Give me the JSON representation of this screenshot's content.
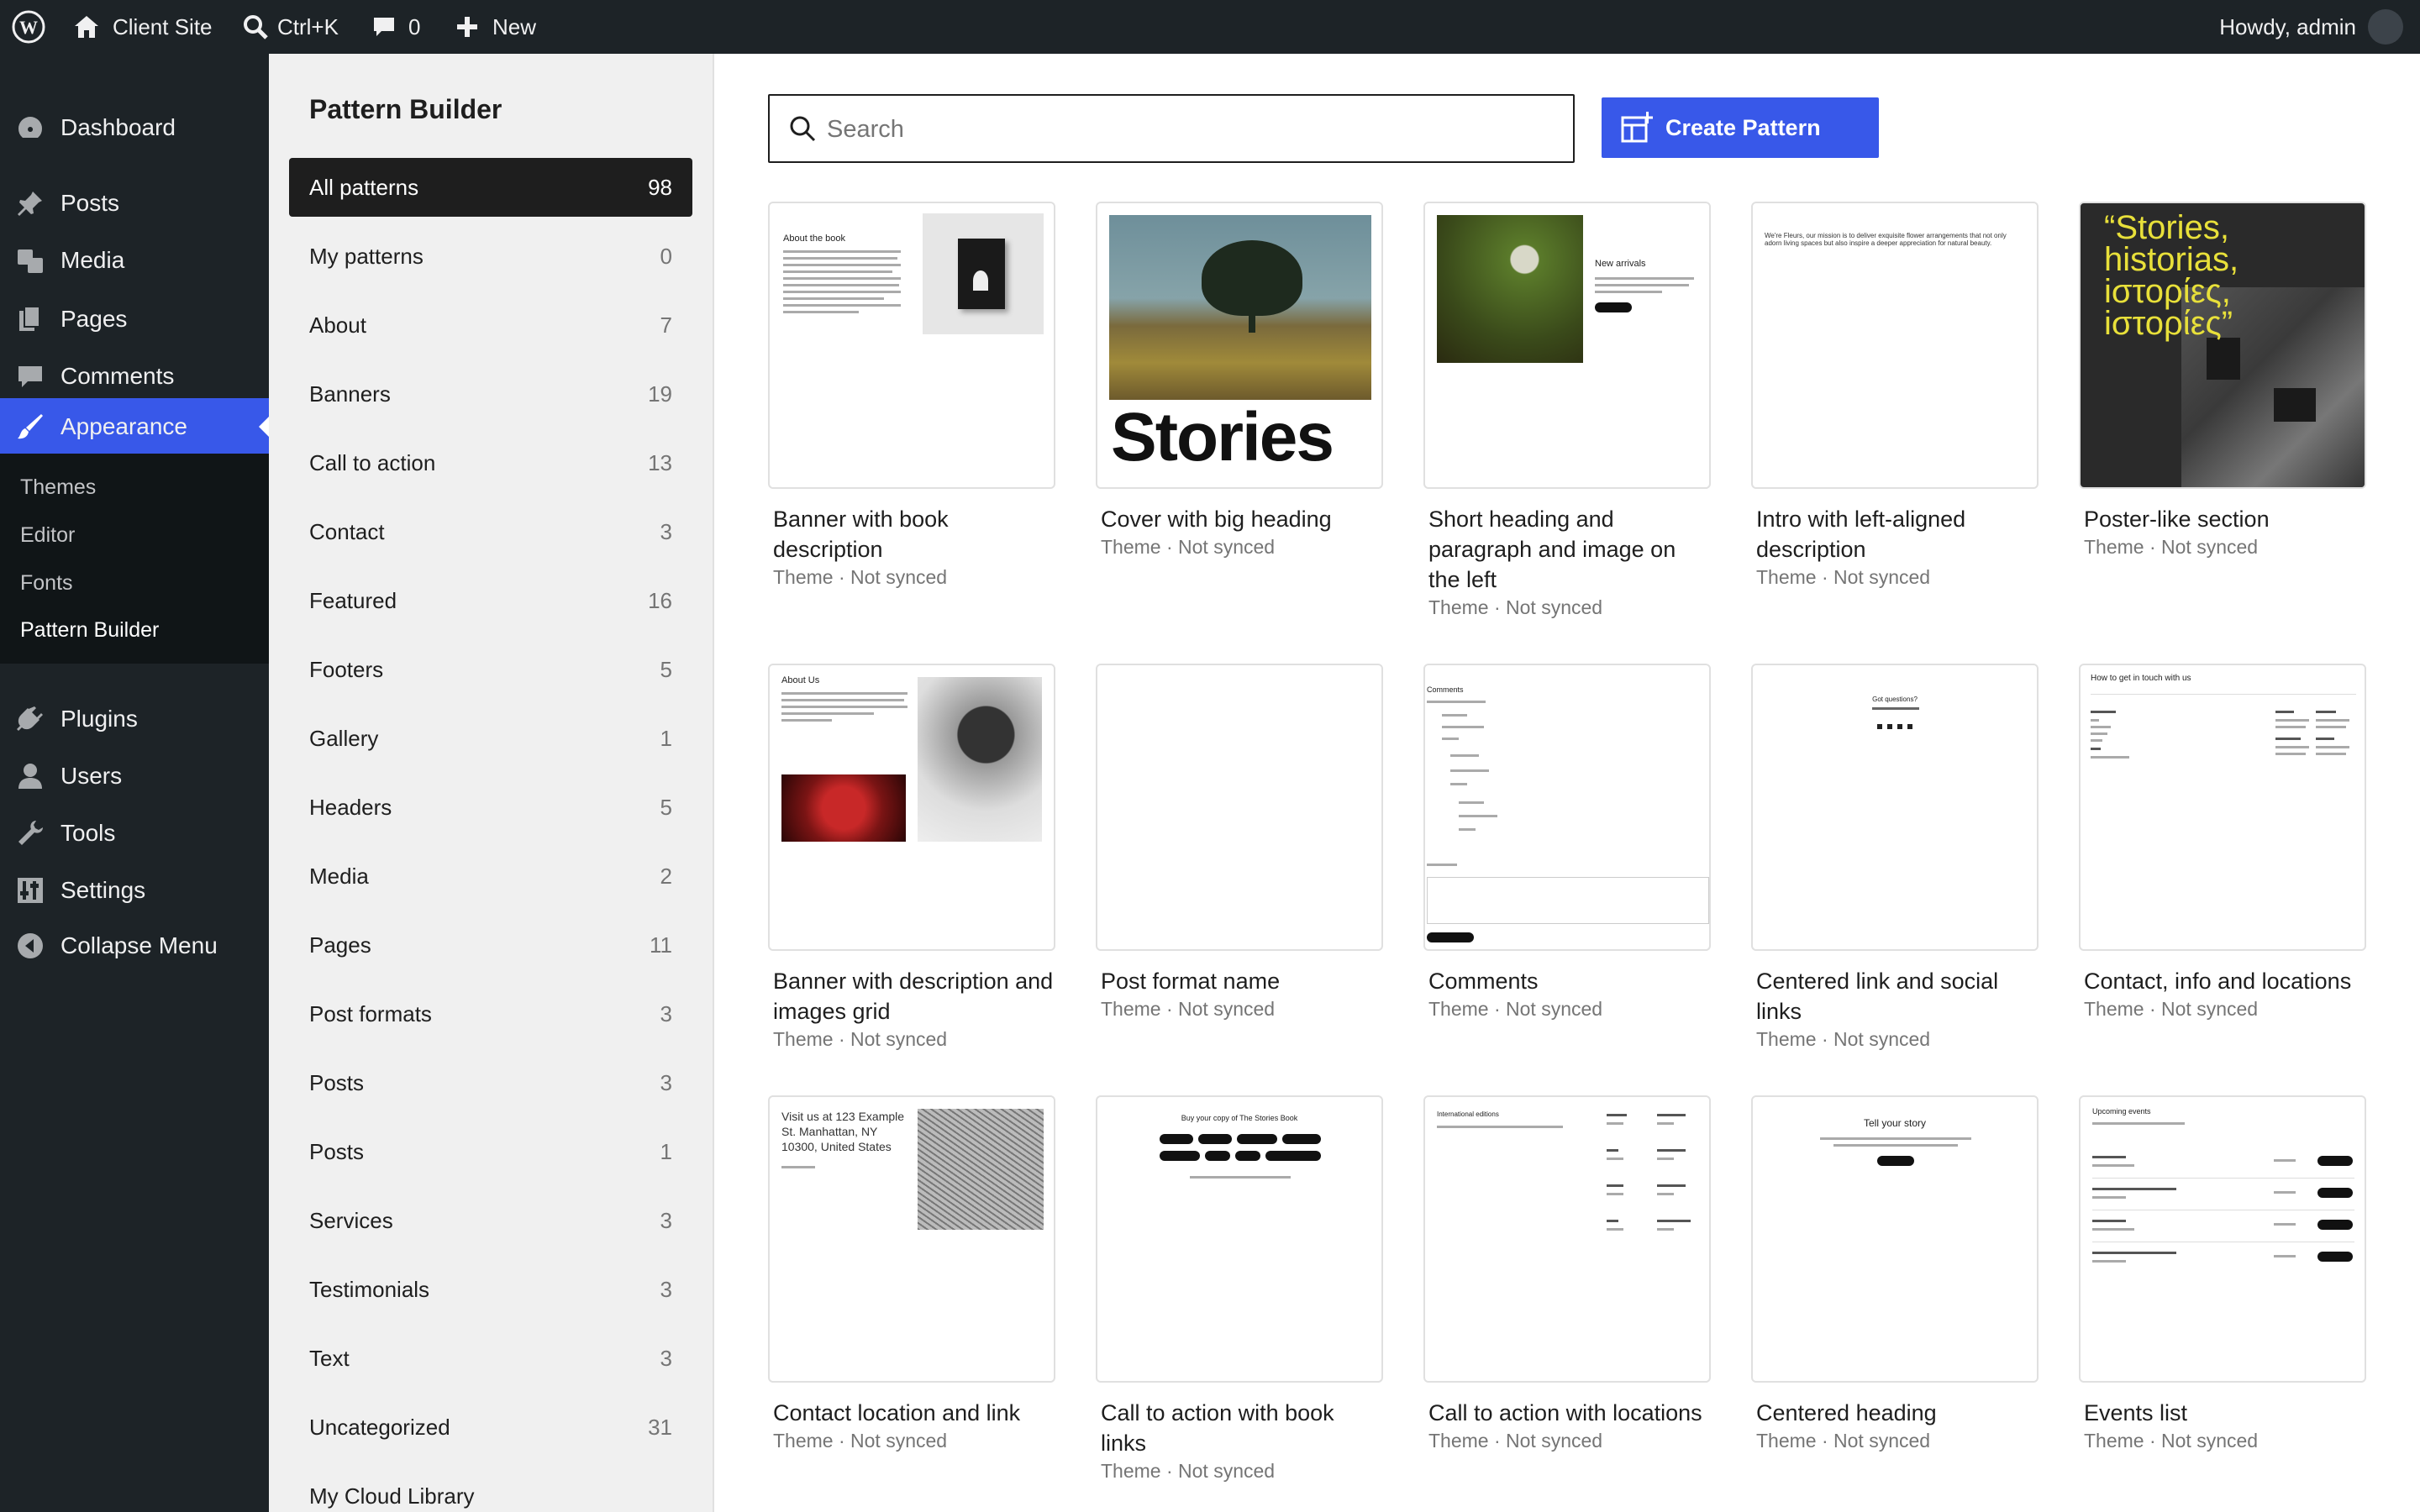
{
  "adminbar": {
    "site_name": "Client Site",
    "search_shortcut": "Ctrl+K",
    "comments_count": "0",
    "new_label": "New",
    "greeting": "Howdy, admin"
  },
  "admin_menu": {
    "items": [
      {
        "label": "Dashboard",
        "icon": "dashboard-icon"
      },
      {
        "label": "Posts",
        "icon": "pin-icon"
      },
      {
        "label": "Media",
        "icon": "media-icon"
      },
      {
        "label": "Pages",
        "icon": "pages-icon"
      },
      {
        "label": "Comments",
        "icon": "comment-icon"
      },
      {
        "label": "Appearance",
        "icon": "brush-icon"
      },
      {
        "label": "Plugins",
        "icon": "plug-icon"
      },
      {
        "label": "Users",
        "icon": "user-icon"
      },
      {
        "label": "Tools",
        "icon": "wrench-icon"
      },
      {
        "label": "Settings",
        "icon": "sliders-icon"
      },
      {
        "label": "Collapse Menu",
        "icon": "collapse-icon"
      }
    ],
    "submenu": [
      "Themes",
      "Editor",
      "Fonts",
      "Pattern Builder"
    ]
  },
  "pattern_builder": {
    "title": "Pattern Builder",
    "categories": [
      {
        "label": "All patterns",
        "count": "98"
      },
      {
        "label": "My patterns",
        "count": "0"
      },
      {
        "label": "About",
        "count": "7"
      },
      {
        "label": "Banners",
        "count": "19"
      },
      {
        "label": "Call to action",
        "count": "13"
      },
      {
        "label": "Contact",
        "count": "3"
      },
      {
        "label": "Featured",
        "count": "16"
      },
      {
        "label": "Footers",
        "count": "5"
      },
      {
        "label": "Gallery",
        "count": "1"
      },
      {
        "label": "Headers",
        "count": "5"
      },
      {
        "label": "Media",
        "count": "2"
      },
      {
        "label": "Pages",
        "count": "11"
      },
      {
        "label": "Post formats",
        "count": "3"
      },
      {
        "label": "Posts",
        "count": "3"
      },
      {
        "label": "Posts",
        "count": "1"
      },
      {
        "label": "Services",
        "count": "3"
      },
      {
        "label": "Testimonials",
        "count": "3"
      },
      {
        "label": "Text",
        "count": "3"
      },
      {
        "label": "Uncategorized",
        "count": "31"
      },
      {
        "label": "My Cloud Library",
        "count": ""
      }
    ]
  },
  "main": {
    "search_placeholder": "Search",
    "create_label": "Create Pattern",
    "patterns": [
      {
        "title": "Banner with book description",
        "meta": "Theme · Not synced"
      },
      {
        "title": "Cover with big heading",
        "meta": "Theme · Not synced"
      },
      {
        "title": "Short heading and paragraph and image on the left",
        "meta": "Theme · Not synced"
      },
      {
        "title": "Intro with left-aligned description",
        "meta": "Theme · Not synced"
      },
      {
        "title": "Poster-like section",
        "meta": "Theme · Not synced"
      },
      {
        "title": "Banner with description and images grid",
        "meta": "Theme · Not synced"
      },
      {
        "title": "Post format name",
        "meta": "Theme · Not synced"
      },
      {
        "title": "Comments",
        "meta": "Theme · Not synced"
      },
      {
        "title": "Centered link and social links",
        "meta": "Theme · Not synced"
      },
      {
        "title": "Contact, info and locations",
        "meta": "Theme · Not synced"
      },
      {
        "title": "Contact location and link",
        "meta": "Theme · Not synced"
      },
      {
        "title": "Call to action with book links",
        "meta": "Theme · Not synced"
      },
      {
        "title": "Call to action with locations",
        "meta": "Theme · Not synced"
      },
      {
        "title": "Centered heading",
        "meta": "Theme · Not synced"
      },
      {
        "title": "Events list",
        "meta": "Theme · Not synced"
      }
    ],
    "thumb_text": {
      "about_book": "About the book",
      "stories": "Stories",
      "new_arrivals": "New arrivals",
      "fleurs_intro": "We're Fleurs, our mission is to deliver exquisite flower arrangements that not only adorn living spaces but also inspire a deeper appreciation for natural beauty.",
      "poster_text": "“Stories, historias, iστορίες, iστορίες”",
      "about_us": "About Us",
      "comments": "Comments",
      "got_questions": "Got questions?",
      "touch": "How to get in touch with us",
      "visit": "Visit us at 123 Example St. Manhattan, NY 10300, United States",
      "buy_copy": "Buy your copy of The Stories Book",
      "intl": "International editions",
      "tell_story": "Tell your story",
      "upcoming": "Upcoming events"
    }
  },
  "colors": {
    "admin_dark": "#1d2327",
    "accent": "#3858e9",
    "sidebar_bg": "#f0f0f0"
  }
}
